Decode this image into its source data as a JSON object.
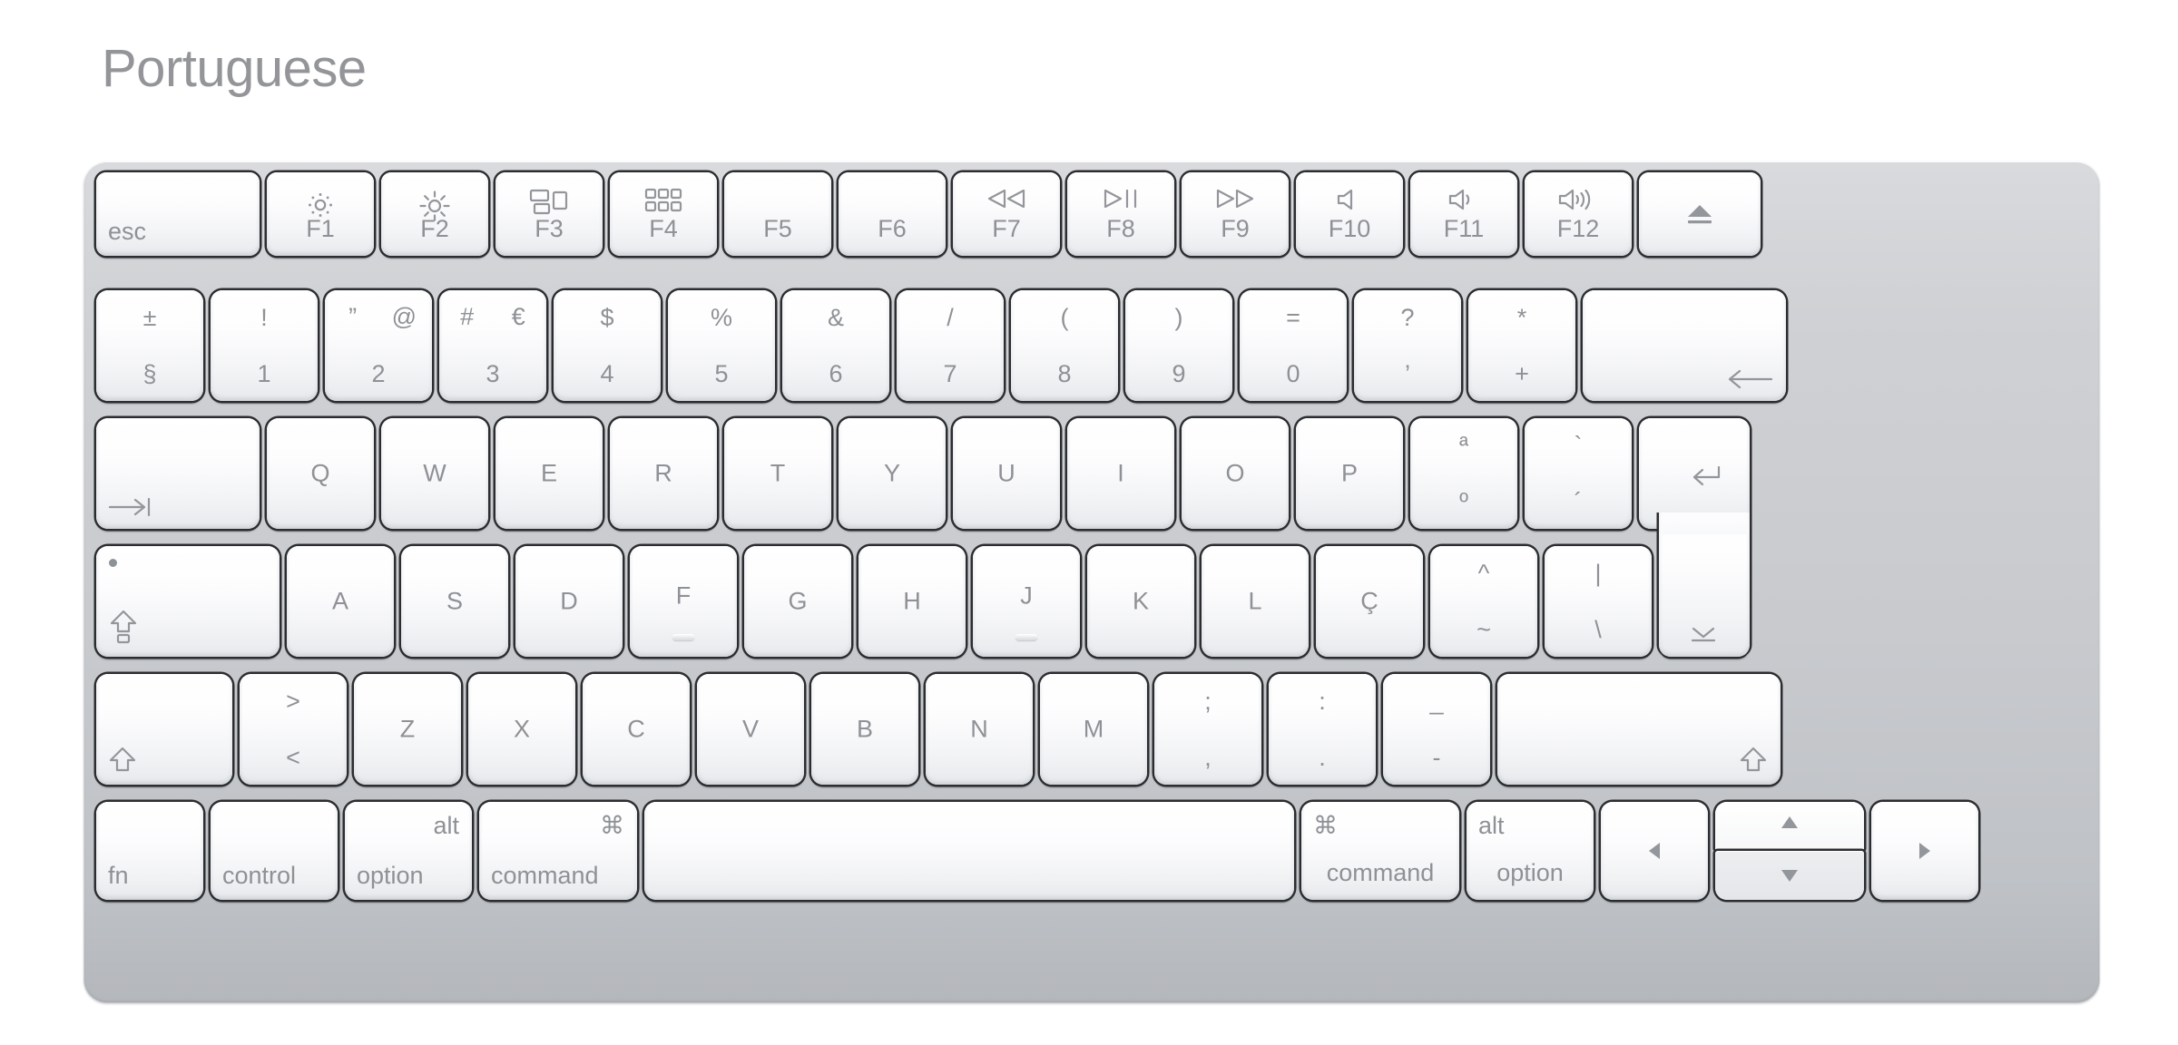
{
  "page": {
    "title": "Portuguese",
    "device": "apple-magic-keyboard",
    "accent_body": "#c8cace",
    "key_face": "#ffffff",
    "legend_color": "#8e9195"
  },
  "rows": {
    "function_row": [
      {
        "name": "esc",
        "label": "esc",
        "icon": null
      },
      {
        "name": "f1",
        "label": "F1",
        "icon": "brightness-down-icon"
      },
      {
        "name": "f2",
        "label": "F2",
        "icon": "brightness-up-icon"
      },
      {
        "name": "f3",
        "label": "F3",
        "icon": "mission-control-icon"
      },
      {
        "name": "f4",
        "label": "F4",
        "icon": "launchpad-icon"
      },
      {
        "name": "f5",
        "label": "F5",
        "icon": null
      },
      {
        "name": "f6",
        "label": "F6",
        "icon": null
      },
      {
        "name": "f7",
        "label": "F7",
        "icon": "rewind-icon"
      },
      {
        "name": "f8",
        "label": "F8",
        "icon": "play-pause-icon"
      },
      {
        "name": "f9",
        "label": "F9",
        "icon": "fast-forward-icon"
      },
      {
        "name": "f10",
        "label": "F10",
        "icon": "volume-mute-icon"
      },
      {
        "name": "f11",
        "label": "F11",
        "icon": "volume-down-icon"
      },
      {
        "name": "f12",
        "label": "F12",
        "icon": "volume-up-icon"
      },
      {
        "name": "eject",
        "label": "",
        "icon": "eject-icon"
      }
    ],
    "number_row": [
      {
        "name": "section",
        "top": "±",
        "bottom": "§"
      },
      {
        "name": "digit-1",
        "top": "!",
        "bottom": "1"
      },
      {
        "name": "digit-2",
        "top": "”",
        "top2": "@",
        "bottom": "2"
      },
      {
        "name": "digit-3",
        "top": "#",
        "top2": "€",
        "bottom": "3"
      },
      {
        "name": "digit-4",
        "top": "$",
        "bottom": "4"
      },
      {
        "name": "digit-5",
        "top": "%",
        "bottom": "5"
      },
      {
        "name": "digit-6",
        "top": "&",
        "bottom": "6"
      },
      {
        "name": "digit-7",
        "top": "/",
        "bottom": "7"
      },
      {
        "name": "digit-8",
        "top": "(",
        "bottom": "8"
      },
      {
        "name": "digit-9",
        "top": ")",
        "bottom": "9"
      },
      {
        "name": "digit-0",
        "top": "=",
        "bottom": "0"
      },
      {
        "name": "quote",
        "top": "?",
        "bottom": "’"
      },
      {
        "name": "plus",
        "top": "*",
        "bottom": "+"
      },
      {
        "name": "delete",
        "icon": "delete-left-arrow-icon"
      }
    ],
    "top_letter_row": [
      {
        "name": "tab",
        "icon": "tab-icon"
      },
      {
        "name": "key-q",
        "label": "Q"
      },
      {
        "name": "key-w",
        "label": "W"
      },
      {
        "name": "key-e",
        "label": "E"
      },
      {
        "name": "key-r",
        "label": "R"
      },
      {
        "name": "key-t",
        "label": "T"
      },
      {
        "name": "key-y",
        "label": "Y"
      },
      {
        "name": "key-u",
        "label": "U"
      },
      {
        "name": "key-i",
        "label": "I"
      },
      {
        "name": "key-o",
        "label": "O"
      },
      {
        "name": "key-p",
        "label": "P"
      },
      {
        "name": "ordinals",
        "top": "ª",
        "bottom": "º"
      },
      {
        "name": "accents",
        "top": "`",
        "bottom": "´"
      },
      {
        "name": "return",
        "icon": "return-icon",
        "icon2": "shift-enter-icon"
      }
    ],
    "home_row": [
      {
        "name": "caps-lock",
        "icon": "caps-lock-icon",
        "indicator": true
      },
      {
        "name": "key-a",
        "label": "A"
      },
      {
        "name": "key-s",
        "label": "S"
      },
      {
        "name": "key-d",
        "label": "D"
      },
      {
        "name": "key-f",
        "label": "F",
        "bump": true
      },
      {
        "name": "key-g",
        "label": "G"
      },
      {
        "name": "key-h",
        "label": "H"
      },
      {
        "name": "key-j",
        "label": "J",
        "bump": true
      },
      {
        "name": "key-k",
        "label": "K"
      },
      {
        "name": "key-l",
        "label": "L"
      },
      {
        "name": "key-ccedil",
        "label": "Ç"
      },
      {
        "name": "circumflex",
        "top": "^",
        "bottom": "~"
      },
      {
        "name": "pipe",
        "top": "|",
        "bottom": "\\"
      }
    ],
    "shift_row": [
      {
        "name": "shift-left",
        "icon": "shift-icon"
      },
      {
        "name": "angle",
        "top": ">",
        "bottom": "<"
      },
      {
        "name": "key-z",
        "label": "Z"
      },
      {
        "name": "key-x",
        "label": "X"
      },
      {
        "name": "key-c",
        "label": "C"
      },
      {
        "name": "key-v",
        "label": "V"
      },
      {
        "name": "key-b",
        "label": "B"
      },
      {
        "name": "key-n",
        "label": "N"
      },
      {
        "name": "key-m",
        "label": "M"
      },
      {
        "name": "semicolon",
        "top": ";",
        "bottom": ","
      },
      {
        "name": "colon",
        "top": ":",
        "bottom": "."
      },
      {
        "name": "dash",
        "top": "_",
        "bottom": "-"
      },
      {
        "name": "shift-right",
        "icon": "shift-icon"
      }
    ],
    "modifier_row": [
      {
        "name": "fn",
        "label": "fn"
      },
      {
        "name": "control",
        "label": "control"
      },
      {
        "name": "option-left",
        "label": "option",
        "top": "alt"
      },
      {
        "name": "command-left",
        "label": "command",
        "top": "⌘"
      },
      {
        "name": "space",
        "label": ""
      },
      {
        "name": "command-right",
        "label": "command",
        "top": "⌘"
      },
      {
        "name": "option-right",
        "label": "option",
        "top": "alt"
      },
      {
        "name": "arrow-left",
        "icon": "arrow-left-icon"
      },
      {
        "name": "arrow-up-down",
        "icon": "arrow-up-icon",
        "icon2": "arrow-down-icon"
      },
      {
        "name": "arrow-right",
        "icon": "arrow-right-icon"
      }
    ]
  }
}
